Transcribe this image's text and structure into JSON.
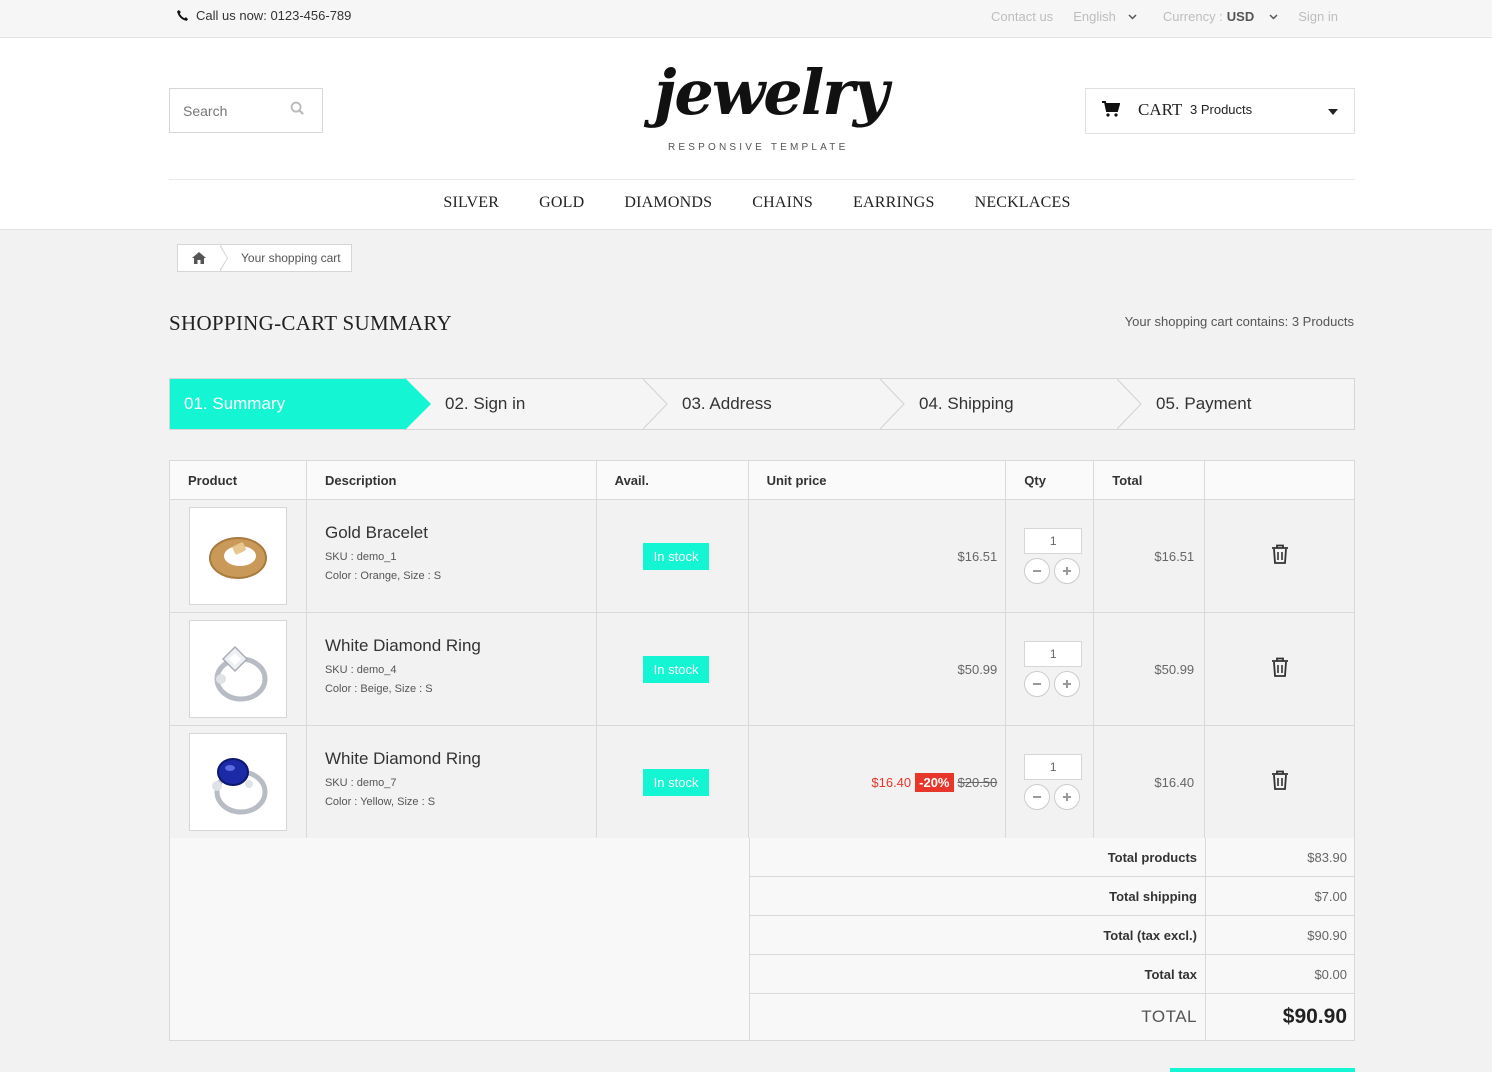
{
  "topbar": {
    "call_label": "Call us now:",
    "phone": "0123-456-789",
    "contact": "Contact us",
    "language": "English",
    "currency_label": "Currency :",
    "currency_value": "USD",
    "signin": "Sign in"
  },
  "header": {
    "search_placeholder": "Search",
    "logo_text": "jewelry",
    "logo_tagline": "RESPONSIVE TEMPLATE",
    "cart_label": "CART",
    "cart_count": "3 Products"
  },
  "nav": [
    "SILVER",
    "GOLD",
    "DIAMONDS",
    "CHAINS",
    "EARRINGS",
    "NECKLACES"
  ],
  "breadcrumb": {
    "current": "Your shopping cart"
  },
  "page": {
    "title": "SHOPPING-CART SUMMARY",
    "contains_label": "Your shopping cart contains:",
    "contains_count": "3 Products"
  },
  "steps": [
    "01. Summary",
    "02. Sign in",
    "03. Address",
    "04. Shipping",
    "05. Payment"
  ],
  "table": {
    "headers": [
      "Product",
      "Description",
      "Avail.",
      "Unit price",
      "Qty",
      "Total",
      ""
    ],
    "rows": [
      {
        "name": "Gold Bracelet",
        "sku": "SKU : demo_1",
        "attrs": "Color : Orange, Size : S",
        "avail": "In stock",
        "unit_price": "$16.51",
        "qty": "1",
        "total": "$16.51"
      },
      {
        "name": "White Diamond Ring",
        "sku": "SKU : demo_4",
        "attrs": "Color : Beige, Size : S",
        "avail": "In stock",
        "unit_price": "$50.99",
        "qty": "1",
        "total": "$50.99"
      },
      {
        "name": "White Diamond Ring",
        "sku": "SKU : demo_7",
        "attrs": "Color : Yellow, Size : S",
        "avail": "In stock",
        "unit_price": "$16.40",
        "discount": "-20%",
        "old_price": "$20.50",
        "qty": "1",
        "total": "$16.40"
      }
    ]
  },
  "summary": {
    "total_products_label": "Total products",
    "total_products": "$83.90",
    "total_shipping_label": "Total shipping",
    "total_shipping": "$7.00",
    "total_tax_excl_label": "Total (tax excl.)",
    "total_tax_excl": "$90.90",
    "total_tax_label": "Total tax",
    "total_tax": "$0.00",
    "grand_label": "TOTAL",
    "grand_total": "$90.90"
  },
  "colors": {
    "accent": "#13f5d3",
    "sale": "#e8362b"
  },
  "icons": [
    "phone-icon",
    "chevron-down-icon",
    "search-icon",
    "cart-icon",
    "home-icon",
    "trash-icon",
    "minus-icon",
    "plus-icon"
  ]
}
